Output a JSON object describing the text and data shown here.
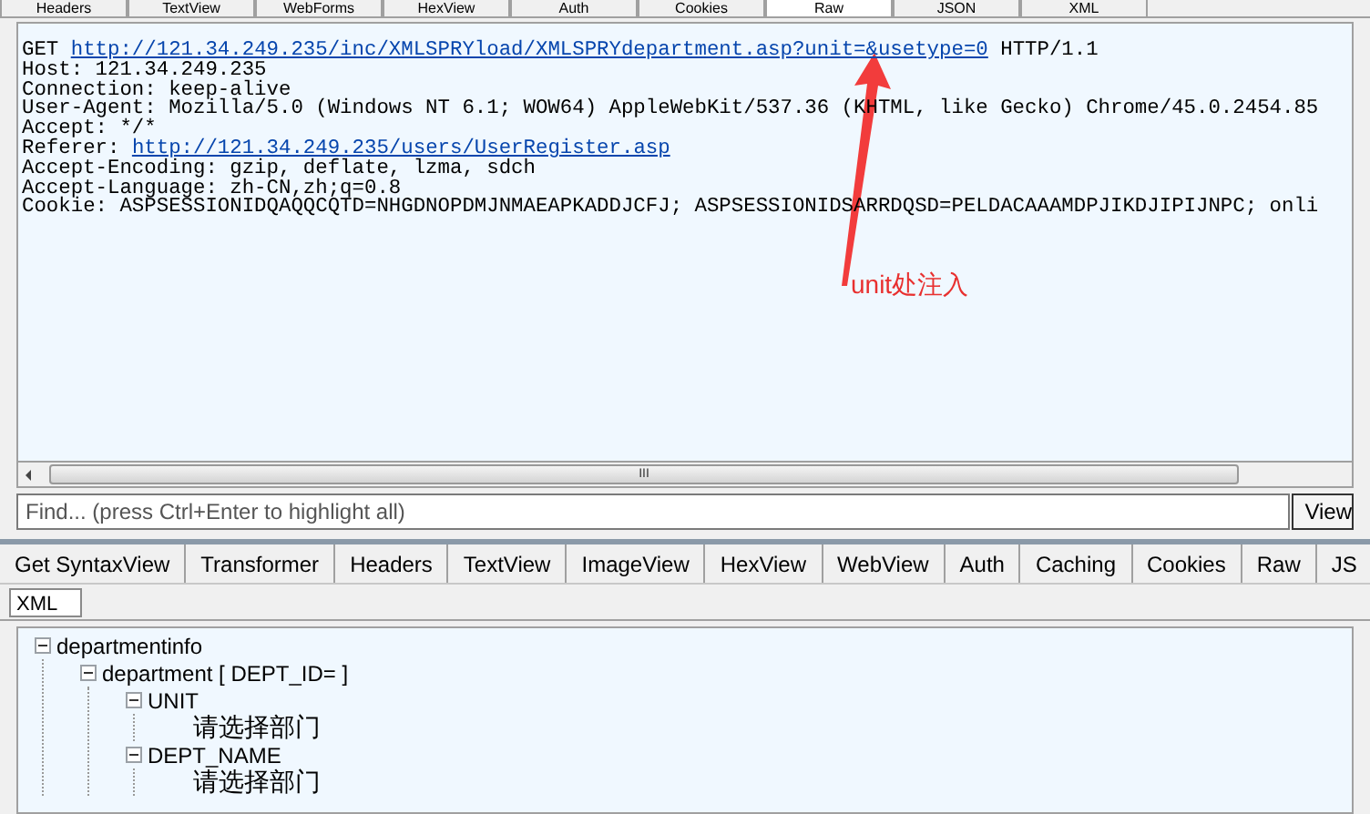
{
  "top_tabs": [
    {
      "label": "Headers",
      "selected": false
    },
    {
      "label": "TextView",
      "selected": false
    },
    {
      "label": "WebForms",
      "selected": false
    },
    {
      "label": "HexView",
      "selected": false
    },
    {
      "label": "Auth",
      "selected": false
    },
    {
      "label": "Cookies",
      "selected": false
    },
    {
      "label": "Raw",
      "selected": true
    },
    {
      "label": "JSON",
      "selected": false
    },
    {
      "label": "XML",
      "selected": false
    }
  ],
  "request_lines": [
    [
      {
        "text": "GET ",
        "link": false
      },
      {
        "text": "http://121.34.249.235/inc/XMLSPRYload/XMLSPRYdepartment.asp?unit=&usetype=0",
        "link": true
      },
      {
        "text": " HTTP/1.1",
        "link": false
      }
    ],
    [
      {
        "text": "Host: 121.34.249.235",
        "link": false
      }
    ],
    [
      {
        "text": "Connection: keep-alive",
        "link": false
      }
    ],
    [
      {
        "text": "User-Agent: Mozilla/5.0 (Windows NT 6.1; WOW64) AppleWebKit/537.36 (KHTML, like Gecko) Chrome/45.0.2454.85",
        "link": false
      }
    ],
    [
      {
        "text": "Accept: */*",
        "link": false
      }
    ],
    [
      {
        "text": "Referer: ",
        "link": false
      },
      {
        "text": "http://121.34.249.235/users/UserRegister.asp",
        "link": true
      }
    ],
    [
      {
        "text": "Accept-Encoding: gzip, deflate, lzma, sdch",
        "link": false
      }
    ],
    [
      {
        "text": "Accept-Language: zh-CN,zh;q=0.8",
        "link": false
      }
    ],
    [
      {
        "text": "Cookie: ASPSESSIONIDQAQQCQTD=NHGDNOPDMJNMAEAPKADDJCFJ; ASPSESSIONIDSARRDQSD=PELDACAAAMDPJIKDJIPIJNPC; onli",
        "link": false
      }
    ]
  ],
  "annotation": {
    "text": "unit处注入"
  },
  "scrollbar": {
    "grip": "III"
  },
  "find": {
    "placeholder": "Find... (press Ctrl+Enter to highlight all)",
    "button": "View"
  },
  "response_tabs": [
    {
      "label": "Get SyntaxView",
      "selected": false
    },
    {
      "label": "Transformer",
      "selected": false
    },
    {
      "label": "Headers",
      "selected": false
    },
    {
      "label": "TextView",
      "selected": false
    },
    {
      "label": "ImageView",
      "selected": false
    },
    {
      "label": "HexView",
      "selected": false
    },
    {
      "label": "WebView",
      "selected": false
    },
    {
      "label": "Auth",
      "selected": false
    },
    {
      "label": "Caching",
      "selected": false
    },
    {
      "label": "Cookies",
      "selected": false
    },
    {
      "label": "Raw",
      "selected": false
    },
    {
      "label": "JS",
      "selected": false
    }
  ],
  "sub_tabs": [
    {
      "label": "XML",
      "selected": true
    }
  ],
  "tree": [
    {
      "label": "departmentinfo",
      "expanded": true,
      "children": [
        {
          "label": "department [ DEPT_ID= ]",
          "expanded": true,
          "children": [
            {
              "label": "UNIT",
              "expanded": true,
              "children": [
                {
                  "label": "请选择部门"
                }
              ]
            },
            {
              "label": "DEPT_NAME",
              "expanded": true,
              "children": [
                {
                  "label": "请选择部门"
                }
              ]
            }
          ]
        }
      ]
    }
  ]
}
